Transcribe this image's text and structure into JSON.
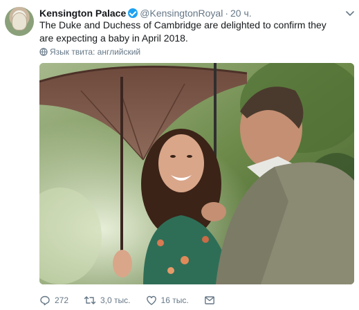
{
  "tweet": {
    "author_name": "Kensington Palace",
    "author_handle": "@KensingtonRoyal",
    "separator": "·",
    "timestamp": "20 ч.",
    "text": "The Duke and Duchess of Cambridge are delighted to confirm they are expecting a baby in April 2018.",
    "translate_label": "Язык твита: английский",
    "verified": true
  },
  "actions": {
    "reply_count": "272",
    "retweet_count": "3,0 тыс.",
    "like_count": "16 тыс."
  },
  "colors": {
    "accent": "#1da1f2",
    "secondary_text": "#657786"
  },
  "icons": [
    "verified-badge-icon",
    "chevron-down-icon",
    "globe-icon",
    "reply-icon",
    "retweet-icon",
    "like-icon",
    "message-icon"
  ]
}
